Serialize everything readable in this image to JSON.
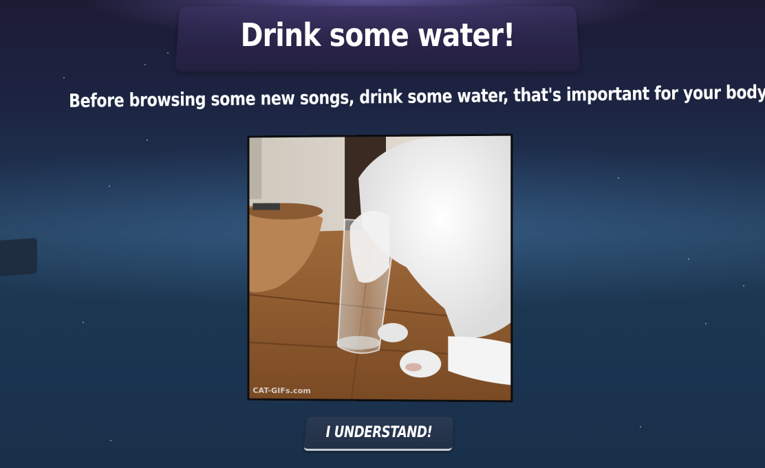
{
  "dialog": {
    "title": "Drink some water!",
    "message": "Before browsing some new songs, drink some water, that's important for your body!",
    "image": {
      "icon": "cat-drinking-water-gif",
      "watermark": "CAT-GIFs.com"
    },
    "confirm_button": {
      "label": "I UNDERSTAND!"
    }
  },
  "colors": {
    "background_top": "#1d1b34",
    "background_mid": "#243f5c",
    "banner": "#2f2853",
    "button": "#263650",
    "text": "#ffffff"
  }
}
